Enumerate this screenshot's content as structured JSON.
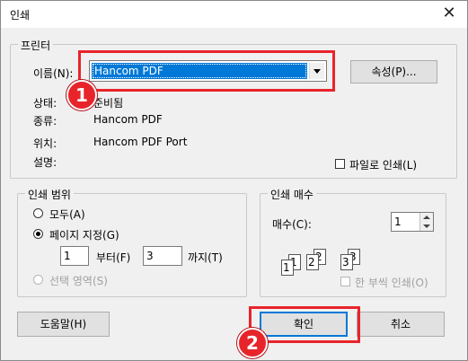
{
  "window": {
    "title": "인쇄",
    "close_glyph": "✕"
  },
  "printer": {
    "legend": "프린터",
    "name_label": "이름(N):",
    "selected": "Hancom PDF",
    "properties_button": "속성(P)...",
    "status_label": "상태:",
    "status_value": "준비됨",
    "type_label": "종류:",
    "type_value": "Hancom PDF",
    "location_label": "위치:",
    "location_value": "Hancom PDF Port",
    "comment_label": "설명:",
    "print_to_file": "파일로 인쇄(L)"
  },
  "range": {
    "legend": "인쇄 범위",
    "all": "모두(A)",
    "pages": "페이지 지정(G)",
    "from_value": "1",
    "from_label": "부터(F)",
    "to_value": "3",
    "to_label": "까지(T)",
    "selection": "선택 영역(S)"
  },
  "copies": {
    "legend": "인쇄 매수",
    "count_label": "매수(C):",
    "count_value": "1",
    "collate_label": "한 부씩 인쇄(O)",
    "collate_pages": [
      "1",
      "1",
      "2",
      "2",
      "3",
      "3"
    ]
  },
  "buttons": {
    "help": "도움말(H)",
    "ok": "확인",
    "cancel": "취소"
  },
  "annotations": {
    "badge1": "1",
    "badge2": "2",
    "accent_color": "#e8242b"
  }
}
